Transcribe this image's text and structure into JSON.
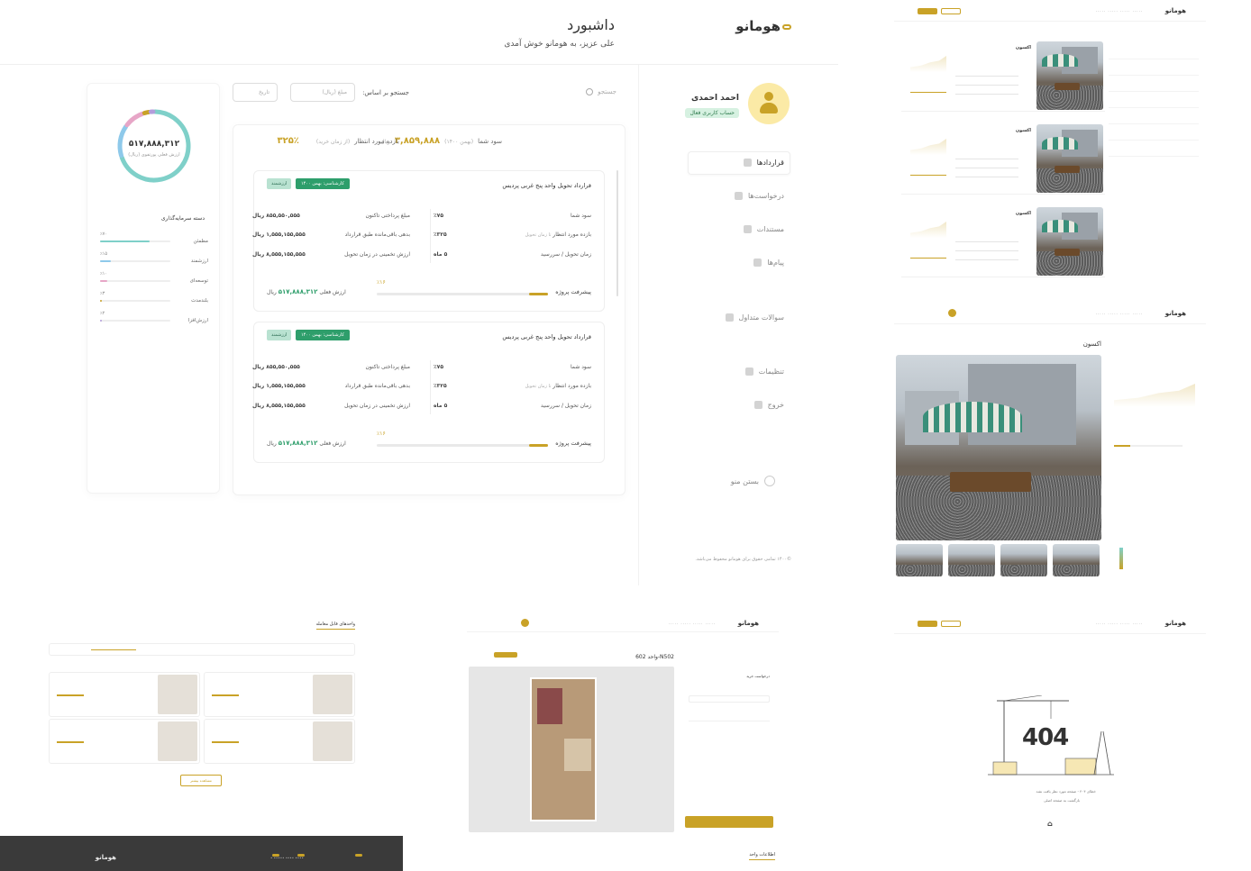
{
  "brand": {
    "logo": "هومانو",
    "accent": "#c9a227",
    "green": "#2e9e6b",
    "teal": "#7fd0c9"
  },
  "header": {
    "title": "داشبورد",
    "subtitle": "علی عزیز، به هومانو خوش آمدی"
  },
  "user": {
    "name": "احمد احمدی",
    "status": "حساب کاربری فعال"
  },
  "sidebar": {
    "items": [
      {
        "label": "قراردادها"
      },
      {
        "label": "درخواست‌ها"
      },
      {
        "label": "مستندات"
      },
      {
        "label": "پیام‌ها"
      },
      {
        "label": "سوالات متداول"
      },
      {
        "label": "تنظیمات"
      },
      {
        "label": "خروج"
      }
    ],
    "collapse_label": "بستن منو",
    "footer": "©۱۴۰۰ تمامی حقوق برای هومانو محفوظ می‌باشد."
  },
  "search": {
    "placeholder": "جستجو",
    "label": "جستجو بر اساس:",
    "amount_placeholder": "مبلغ (ریال)",
    "date_placeholder": "تاریخ"
  },
  "summary": {
    "profit_label": "سود شما",
    "profit_hint": "(بهمن ۱۴۰۰)",
    "profit_value": "۳,۸۵۹,۸۸۸",
    "profit_unit": "ریال",
    "return_label": "بازده مورد انتظار",
    "return_hint": "(از زمان خرید)",
    "return_value": "۳۲۵٪"
  },
  "contracts": [
    {
      "title": "قرارداد تحویل واحد پنج غربی پردیس",
      "tag": "کارشناسی: بهمن ۱۴۰۰",
      "tag2": "ارزشمند",
      "paid_label": "مبلغ پرداختی تاکنون",
      "paid_value": "۸۵۵,۵۵۰,۵۵۵",
      "remaining_label": "بدهی باقی‌مانده طبق قرارداد",
      "remaining_value": "۱,۵۵۵,۱۵۵,۵۵۵",
      "estimate_label": "ارزش تخمینی در زمان تحویل",
      "estimate_value": "۸,۵۵۵,۱۵۵,۵۵۵",
      "profit_label": "سود شما",
      "profit_value": "٪۷۵",
      "return_label": "بازده مورد انتظار",
      "return_hint": "تا زمان تحویل",
      "return_value": "٪۳۲۵",
      "delivery_label": "زمان تحویل / سررسید",
      "delivery_value": "۵ ماه",
      "progress_label": "پیشرفت پروژه",
      "progress_pct_text": "٪۱۶",
      "progress": 0.11,
      "current_label": "ارزش فعلی",
      "current_value": "۵۱۷,۸۸۸,۳۱۲",
      "unit": "ریال"
    },
    {
      "title": "قرارداد تحویل واحد پنج غربی پردیس",
      "tag": "کارشناسی: بهمن ۱۴۰۰",
      "tag2": "ارزشمند",
      "paid_label": "مبلغ پرداختی تاکنون",
      "paid_value": "۸۵۵,۵۵۰,۵۵۵",
      "remaining_label": "بدهی باقی‌مانده طبق قرارداد",
      "remaining_value": "۱,۵۵۵,۱۵۵,۵۵۵",
      "estimate_label": "ارزش تخمینی در زمان تحویل",
      "estimate_value": "۸,۵۵۵,۱۵۵,۵۵۵",
      "profit_label": "سود شما",
      "profit_value": "٪۷۵",
      "return_label": "بازده مورد انتظار",
      "return_hint": "تا زمان تحویل",
      "return_value": "٪۳۲۵",
      "delivery_label": "زمان تحویل / سررسید",
      "delivery_value": "۵ ماه",
      "progress_label": "پیشرفت پروژه",
      "progress_pct_text": "٪۱۶",
      "progress": 0.11,
      "current_label": "ارزش فعلی",
      "current_value": "۵۱۷,۸۸۸,۳۱۲",
      "unit": "ریال"
    }
  ],
  "portfolio": {
    "total_value": "۵۱۷,۸۸۸,۳۱۲",
    "total_label": "ارزش فعلی پورتفوی (ریال)",
    "title": "دسته سرمایه‌گذاری",
    "rows": [
      {
        "name": "مطمئن",
        "pct": "٪۷۰",
        "value": 0.7,
        "color": "#7fd0c9"
      },
      {
        "name": "ارزشمند",
        "pct": "٪۱۵",
        "value": 0.15,
        "color": "#8ec9ea"
      },
      {
        "name": "توسعه‌ای",
        "pct": "٪۱۰",
        "value": 0.1,
        "color": "#e7a6c7"
      },
      {
        "name": "بلندمدت",
        "pct": "٪۳",
        "value": 0.03,
        "color": "#c9a227"
      },
      {
        "name": "ارزش‌افزا",
        "pct": "٪۲",
        "value": 0.02,
        "color": "#b39ddb"
      }
    ]
  },
  "mock_listing": {
    "title": "اکسون"
  },
  "mock_detail": {
    "title": "اکسون"
  },
  "mock_units": {
    "title": "واحدهای قابل معامله",
    "more": "مشاهده بیشتر"
  },
  "mock_unit_detail": {
    "title": "واحد 602-N502",
    "info": "اطلاعات واحد",
    "request": "درخواست خرید"
  },
  "mock_404": {
    "code": "404",
    "message": "خطای ۴۰۴ - صفحه مورد نظر یافت نشد",
    "back": "بازگشت به صفحه اصلی"
  }
}
